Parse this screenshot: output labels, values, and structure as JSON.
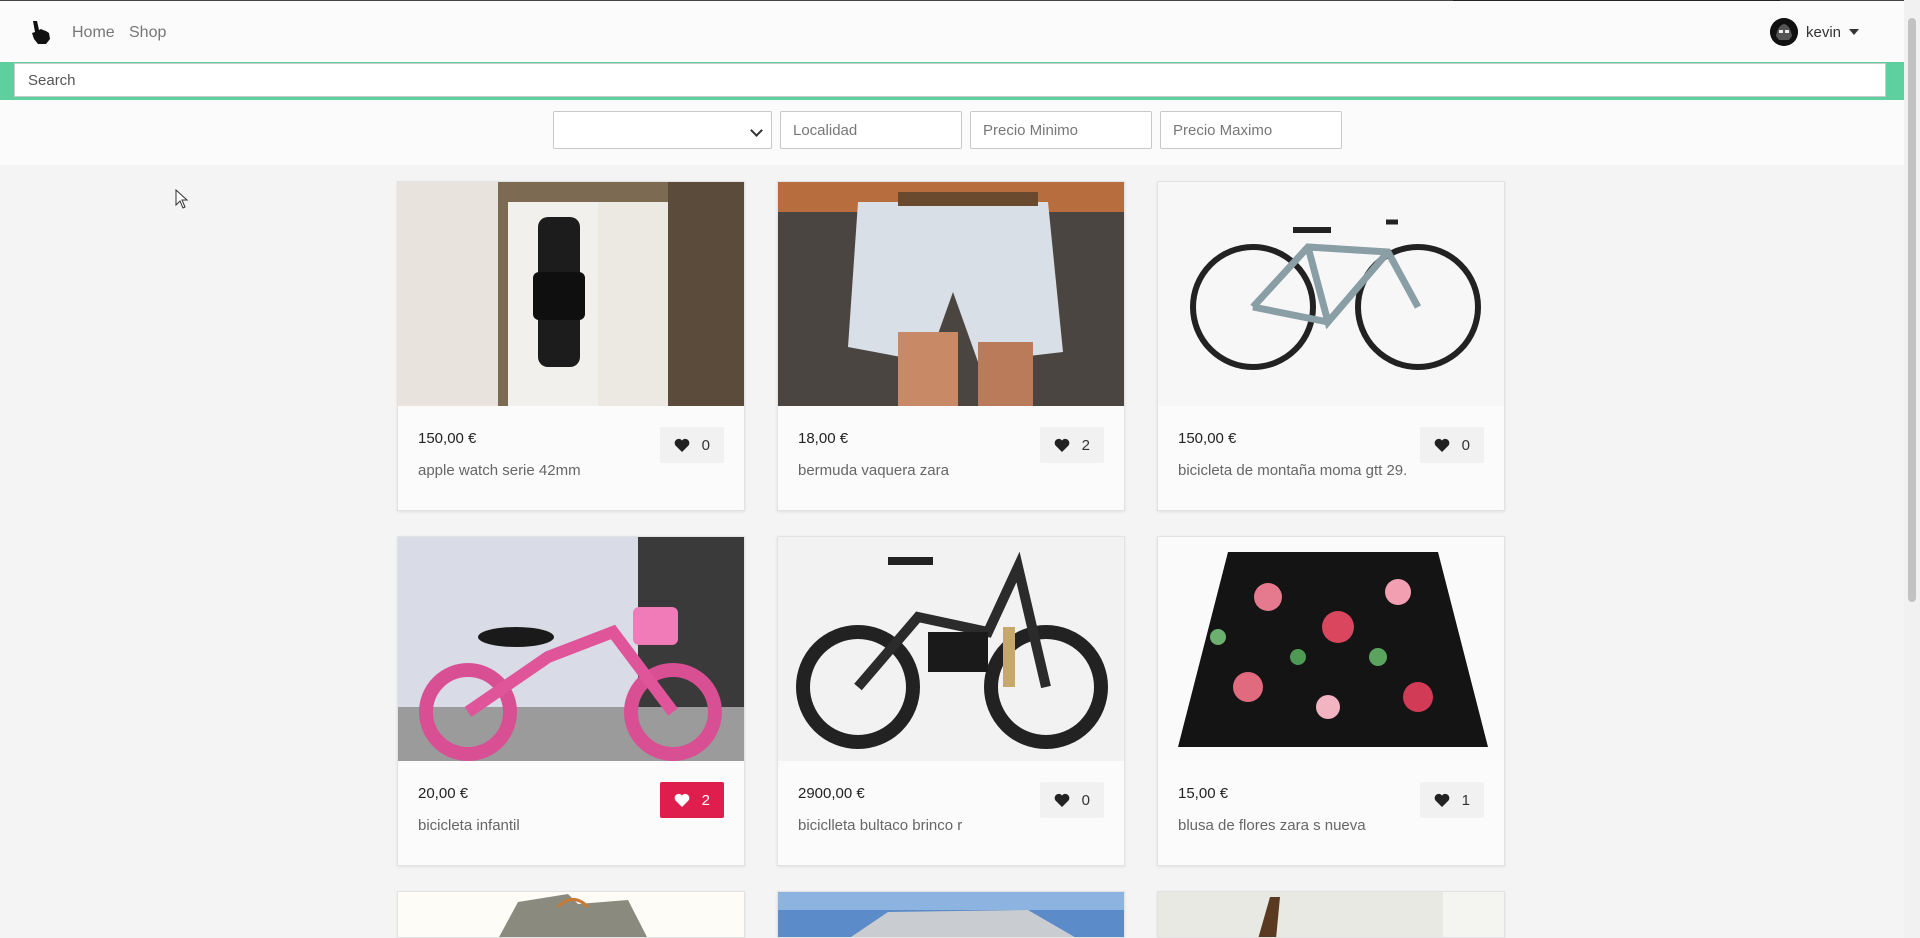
{
  "nav": {
    "home_label": "Home",
    "shop_label": "Shop",
    "user_name": "kevin"
  },
  "search": {
    "placeholder": "Search"
  },
  "filters": {
    "category_value": "",
    "location_placeholder": "Localidad",
    "min_price_placeholder": "Precio Minimo",
    "max_price_placeholder": "Precio Maximo"
  },
  "products": [
    {
      "price": "150,00 €",
      "title": "apple watch serie 42mm",
      "likes": "0",
      "liked": false,
      "image": "watch-image"
    },
    {
      "price": "18,00 €",
      "title": "bermuda vaquera zara",
      "likes": "2",
      "liked": false,
      "image": "shorts-image"
    },
    {
      "price": "150,00 €",
      "title": "bicicleta de montaña moma gtt 29.",
      "likes": "0",
      "liked": false,
      "image": "mountain-bike-image"
    },
    {
      "price": "20,00 €",
      "title": "bicicleta infantil",
      "likes": "2",
      "liked": true,
      "image": "kids-bike-image"
    },
    {
      "price": "2900,00 €",
      "title": "biciclleta bultaco brinco r",
      "likes": "0",
      "liked": false,
      "image": "ebike-image"
    },
    {
      "price": "15,00 €",
      "title": "blusa de flores zara s nueva",
      "likes": "1",
      "liked": false,
      "image": "blouse-image"
    }
  ],
  "colors": {
    "accent": "#5ecf9f",
    "liked": "#e01e4e"
  }
}
